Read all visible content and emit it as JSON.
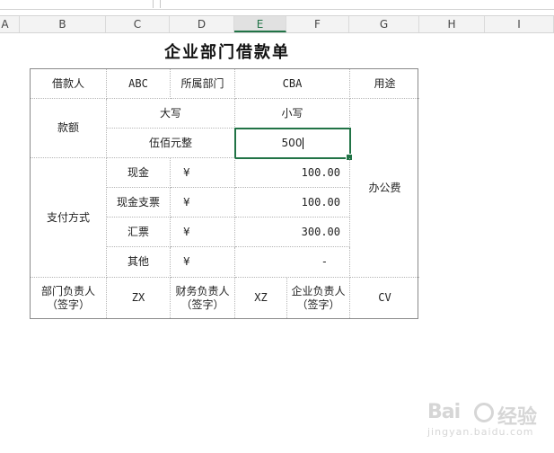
{
  "formula_bar": {
    "content": "500"
  },
  "columns": [
    {
      "id": "A",
      "label": "A"
    },
    {
      "id": "B",
      "label": "B"
    },
    {
      "id": "C",
      "label": "C"
    },
    {
      "id": "D",
      "label": "D"
    },
    {
      "id": "E",
      "label": "E"
    },
    {
      "id": "F",
      "label": "F"
    },
    {
      "id": "G",
      "label": "G"
    },
    {
      "id": "H",
      "label": "H"
    },
    {
      "id": "I",
      "label": "I"
    }
  ],
  "selected_column": "E",
  "title": "企业部门借款单",
  "form": {
    "borrower_label": "借款人",
    "borrower_value": "ABC",
    "dept_label": "所属部门",
    "dept_value": "CBA",
    "purpose_label": "用途",
    "purpose_value": "办公费",
    "amount_label": "款额",
    "upper_label": "大写",
    "lower_label": "小写",
    "upper_value": "伍佰元整",
    "lower_value": "500",
    "payment_label": "支付方式",
    "payments": [
      {
        "method": "现金",
        "currency": "¥",
        "amount": "100.00"
      },
      {
        "method": "现金支票",
        "currency": "¥",
        "amount": "100.00"
      },
      {
        "method": "汇票",
        "currency": "¥",
        "amount": "300.00"
      },
      {
        "method": "其他",
        "currency": "¥",
        "amount": "-"
      }
    ],
    "dept_head_label": "部门负责人\n（签字）",
    "dept_head_value": "ZX",
    "finance_head_label": "财务负责人\n（签字）",
    "finance_head_value": "XZ",
    "company_head_label": "企业负责人\n（签字）",
    "company_head_value": "CV"
  },
  "watermark": {
    "brand_a": "Bai",
    "brand_b": "经验",
    "url": "jingyan.baidu.com"
  }
}
